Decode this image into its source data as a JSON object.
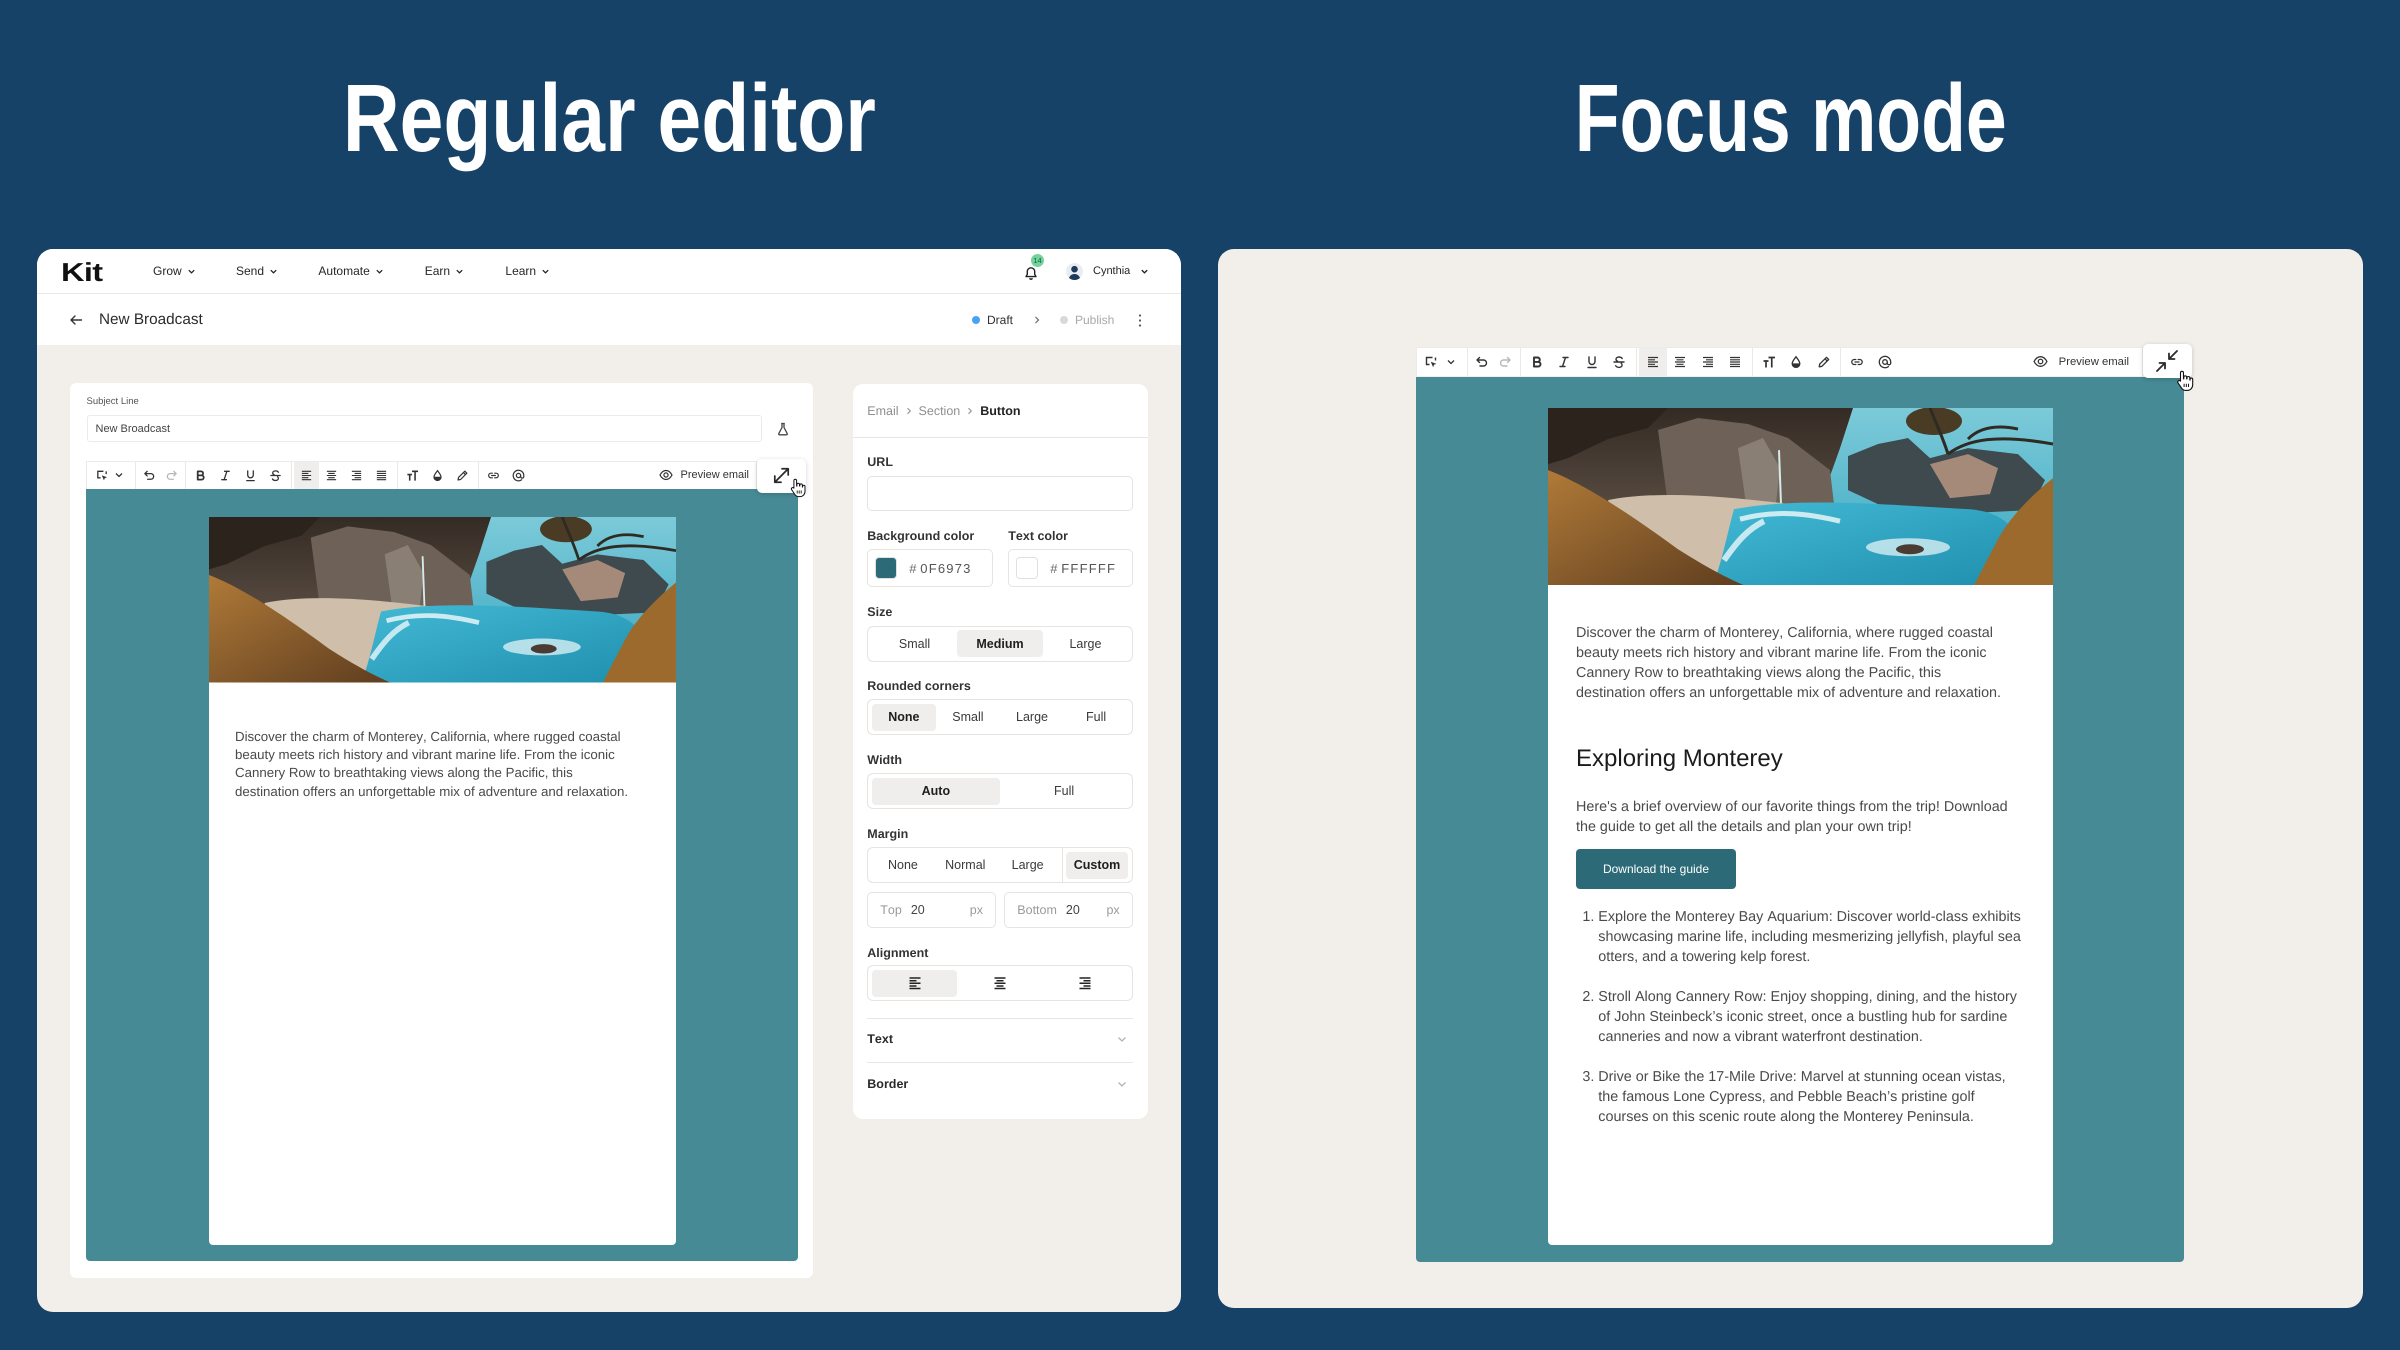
{
  "headings": {
    "regular": "Regular editor",
    "focus": "Focus mode"
  },
  "colors": {
    "page_background": "#174268",
    "card_background": "#f2eeea",
    "email_canvas": "#468a95",
    "email_button": "#2d6a77",
    "draft_status": "#4aa3f0",
    "notification_badge": "#72d49c"
  },
  "regular_editor": {
    "nav": {
      "logo": "Kit",
      "menu": [
        {
          "label": "Grow"
        },
        {
          "label": "Send"
        },
        {
          "label": "Automate"
        },
        {
          "label": "Earn"
        },
        {
          "label": "Learn"
        }
      ],
      "notification_count": "14",
      "user_name": "Cynthia"
    },
    "page_header": {
      "title": "New Broadcast",
      "steps": [
        {
          "label": "Draft",
          "state": "current"
        },
        {
          "label": "Publish",
          "state": "upcoming"
        }
      ]
    },
    "subject_line": {
      "label": "Subject Line",
      "value": "New Broadcast"
    },
    "toolbar": {
      "tools": [
        "select-block",
        "undo",
        "redo",
        "bold",
        "italic",
        "underline",
        "strikethrough",
        "align-left",
        "align-center",
        "align-right",
        "align-justify",
        "text-size",
        "fill-color",
        "highlight",
        "link",
        "mention"
      ],
      "active_tool": "align-left",
      "disabled_tools": [
        "redo"
      ],
      "preview_label": "Preview email",
      "mode_toggle": "enter-focus-mode"
    },
    "email": {
      "paragraph": "Discover the charm of Monterey, California, where rugged coastal beauty meets rich history and vibrant marine life. From the iconic Cannery Row to breathtaking views along the Pacific, this destination offers an unforgettable mix of adventure and relaxation."
    },
    "settings": {
      "breadcrumb": [
        "Email",
        "Section",
        "Button"
      ],
      "url": {
        "label": "URL",
        "value": ""
      },
      "background_color": {
        "label": "Background color",
        "prefix": "#",
        "hex": "0F6973",
        "swatch": "#2d6a77"
      },
      "text_color": {
        "label": "Text color",
        "prefix": "#",
        "hex": "FFFFFF",
        "swatch": "#ffffff"
      },
      "size": {
        "label": "Size",
        "options": [
          "Small",
          "Medium",
          "Large"
        ],
        "selected": "Medium"
      },
      "rounded_corners": {
        "label": "Rounded corners",
        "options": [
          "None",
          "Small",
          "Large",
          "Full"
        ],
        "selected": "None"
      },
      "width": {
        "label": "Width",
        "options": [
          "Auto",
          "Full"
        ],
        "selected": "Auto"
      },
      "margin": {
        "label": "Margin",
        "options": [
          "None",
          "Normal",
          "Large",
          "Custom"
        ],
        "selected": "Custom",
        "top": {
          "label": "Top",
          "value": "20",
          "unit": "px"
        },
        "bottom": {
          "label": "Bottom",
          "value": "20",
          "unit": "px"
        }
      },
      "alignment": {
        "label": "Alignment",
        "options": [
          "left",
          "center",
          "right"
        ],
        "selected": "left"
      },
      "sections": [
        {
          "label": "Text",
          "expanded": false
        },
        {
          "label": "Border",
          "expanded": false
        }
      ]
    }
  },
  "focus_mode": {
    "toolbar": {
      "tools": [
        "select-block",
        "undo",
        "redo",
        "bold",
        "italic",
        "underline",
        "strikethrough",
        "align-left",
        "align-center",
        "align-right",
        "align-justify",
        "text-size",
        "fill-color",
        "highlight",
        "link",
        "mention"
      ],
      "active_tool": "align-left",
      "disabled_tools": [
        "redo"
      ],
      "preview_label": "Preview email",
      "mode_toggle": "exit-focus-mode"
    },
    "email": {
      "intro": "Discover the charm of Monterey, California, where rugged coastal beauty meets rich history and vibrant marine life. From the iconic Cannery Row to breathtaking views along the Pacific, this destination offers an unforgettable mix of adventure and relaxation.",
      "heading": "Exploring Monterey",
      "overview": "Here's a brief overview of our favorite things from the trip! Download the guide to get all the details and plan your own trip!",
      "button_label": "Download the guide",
      "list": [
        "Explore the Monterey Bay Aquarium: Discover world-class exhibits showcasing marine life, including mesmerizing jellyfish, playful sea otters, and a towering kelp forest.",
        "Stroll Along Cannery Row: Enjoy shopping, dining, and the history of John Steinbeck’s iconic street, once a bustling hub for sardine canneries and now a vibrant waterfront destination.",
        "Drive or Bike the 17-Mile Drive: Marvel at stunning ocean vistas, the famous Lone Cypress, and Pebble Beach’s pristine golf courses on this scenic route along the Monterey Peninsula."
      ]
    }
  }
}
